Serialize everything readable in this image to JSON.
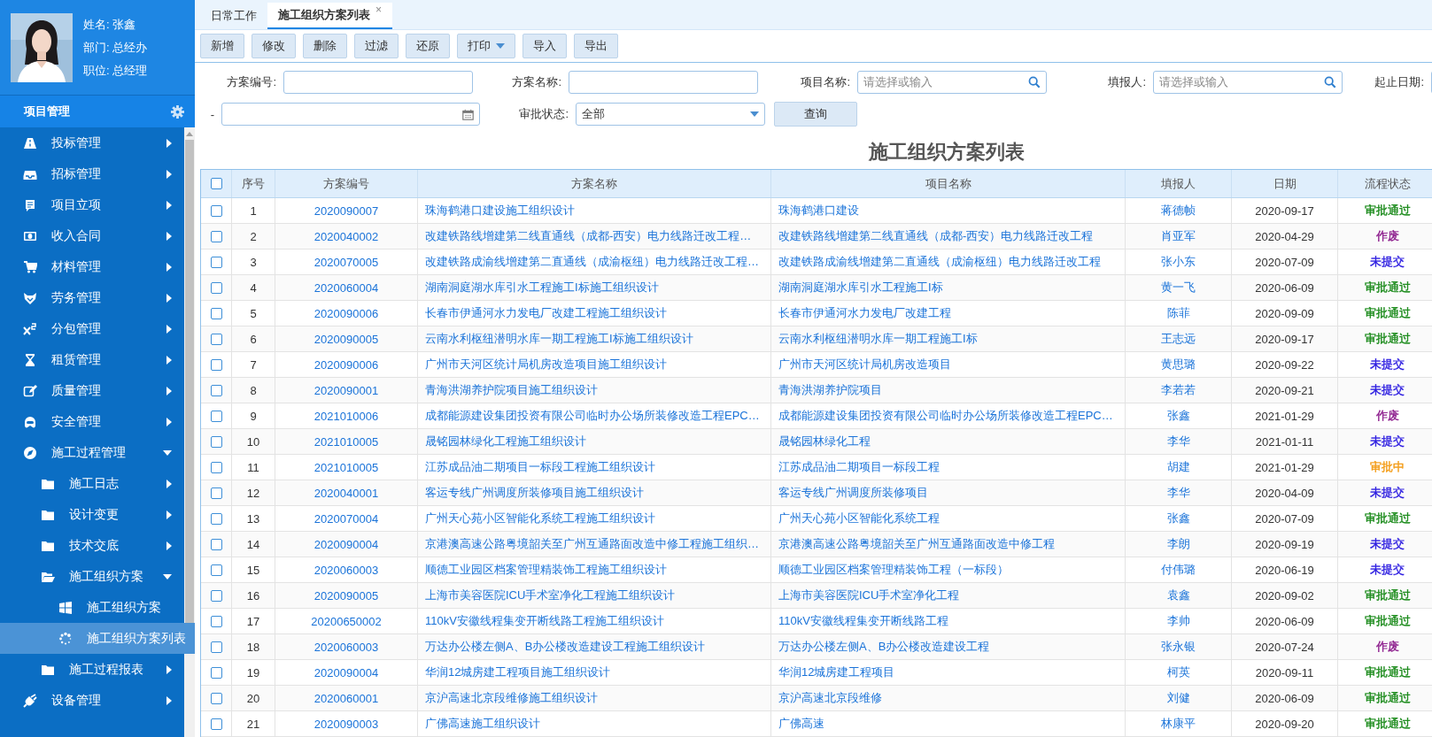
{
  "profile": {
    "lines": [
      "姓名: 张鑫",
      "部门: 总经办",
      "职位: 总经理"
    ]
  },
  "module": {
    "title": "项目管理"
  },
  "menu": [
    {
      "label": "投标管理",
      "expanded": false,
      "selected": false
    },
    {
      "label": "招标管理",
      "expanded": false,
      "selected": false
    },
    {
      "label": "项目立项",
      "expanded": false,
      "selected": false
    },
    {
      "label": "收入合同",
      "expanded": false,
      "selected": false
    },
    {
      "label": "材料管理",
      "expanded": false,
      "selected": false
    },
    {
      "label": "劳务管理",
      "expanded": false,
      "selected": false
    },
    {
      "label": "分包管理",
      "expanded": false,
      "selected": false
    },
    {
      "label": "租赁管理",
      "expanded": false,
      "selected": false
    },
    {
      "label": "质量管理",
      "expanded": false,
      "selected": false
    },
    {
      "label": "安全管理",
      "expanded": false,
      "selected": false
    },
    {
      "label": "施工过程管理",
      "expanded": true,
      "selected": false,
      "children": [
        {
          "label": "施工日志",
          "expanded": false,
          "selected": false
        },
        {
          "label": "设计变更",
          "expanded": false,
          "selected": false
        },
        {
          "label": "技术交底",
          "expanded": false,
          "selected": false
        },
        {
          "label": "施工组织方案",
          "expanded": true,
          "selected": false,
          "children": [
            {
              "label": "施工组织方案",
              "selected": false
            },
            {
              "label": "施工组织方案列表",
              "selected": true
            }
          ]
        },
        {
          "label": "施工过程报表",
          "expanded": false,
          "selected": false
        }
      ]
    },
    {
      "label": "设备管理",
      "expanded": false,
      "selected": false
    }
  ],
  "tabs": [
    {
      "label": "日常工作",
      "selected": false
    },
    {
      "label": "施工组织方案列表",
      "selected": true,
      "close": "×"
    }
  ],
  "toolbar": [
    {
      "label": "新增",
      "kind": "plain"
    },
    {
      "label": "修改",
      "kind": "plain"
    },
    {
      "label": "删除",
      "kind": "plain"
    },
    {
      "label": "过滤",
      "kind": "plain"
    },
    {
      "label": "还原",
      "kind": "plain"
    },
    {
      "label": "打印",
      "kind": "dropdown"
    },
    {
      "label": "导入",
      "kind": "plain"
    },
    {
      "label": "导出",
      "kind": "plain"
    }
  ],
  "filters": [
    {
      "label": "方案编号:",
      "kind": "text"
    },
    {
      "label": "方案名称:",
      "kind": "text"
    },
    {
      "label": "项目名称:",
      "kind": "search",
      "placeholder": "请选择或输入"
    },
    {
      "label": "填报人:",
      "kind": "search",
      "placeholder": "请选择或输入"
    },
    {
      "label": "起止日期:",
      "kind": "text"
    },
    {
      "label": "-",
      "kind": "date"
    },
    {
      "label": "审批状态:",
      "kind": "select",
      "value": "全部"
    }
  ],
  "query_button": "查询",
  "table": {
    "title": "施工组织方案列表",
    "header_checked": false,
    "columns": [
      "序号",
      "方案编号",
      "方案名称",
      "项目名称",
      "填报人",
      "日期",
      "流程状态"
    ],
    "rows": [
      {
        "checked": false,
        "no": "1",
        "code": "2020090007",
        "name": "珠海鹤港口建设施工组织设计",
        "project": "珠海鹤港口建设",
        "reporter": "蒋德帧",
        "date": "2020-09-17",
        "status": "审批通过",
        "color": "#1a8a1a"
      },
      {
        "checked": false,
        "no": "2",
        "code": "2020040002",
        "name": "改建铁路线增建第二线直通线（成都-西安）电力线路迁改工程…",
        "project": "改建铁路线增建第二线直通线（成都-西安）电力线路迁改工程",
        "reporter": "肖亚军",
        "date": "2020-04-29",
        "status": "作废",
        "color": "#8b1a8b"
      },
      {
        "checked": false,
        "no": "3",
        "code": "2020070005",
        "name": "改建铁路成渝线增建第二直通线（成渝枢纽）电力线路迁改工程…",
        "project": "改建铁路成渝线增建第二直通线（成渝枢纽）电力线路迁改工程",
        "reporter": "张小东",
        "date": "2020-07-09",
        "status": "未提交",
        "color": "#2a1ae0"
      },
      {
        "checked": false,
        "no": "4",
        "code": "2020060004",
        "name": "湖南洞庭湖水库引水工程施工I标施工组织设计",
        "project": "湖南洞庭湖水库引水工程施工I标",
        "reporter": "黄一飞",
        "date": "2020-06-09",
        "status": "审批通过",
        "color": "#1a8a1a"
      },
      {
        "checked": false,
        "no": "5",
        "code": "2020090006",
        "name": "长春市伊通河水力发电厂改建工程施工组织设计",
        "project": "长春市伊通河水力发电厂改建工程",
        "reporter": "陈菲",
        "date": "2020-09-09",
        "status": "审批通过",
        "color": "#1a8a1a"
      },
      {
        "checked": false,
        "no": "6",
        "code": "2020090005",
        "name": "云南水利枢纽潜明水库一期工程施工I标施工组织设计",
        "project": "云南水利枢纽潜明水库一期工程施工I标",
        "reporter": "王志远",
        "date": "2020-09-17",
        "status": "审批通过",
        "color": "#1a8a1a"
      },
      {
        "checked": false,
        "no": "7",
        "code": "2020090006",
        "name": "广州市天河区统计局机房改造项目施工组织设计",
        "project": "广州市天河区统计局机房改造项目",
        "reporter": "黄思璐",
        "date": "2020-09-22",
        "status": "未提交",
        "color": "#2a1ae0"
      },
      {
        "checked": false,
        "no": "8",
        "code": "2020090001",
        "name": "青海洪湖养护院项目施工组织设计",
        "project": "青海洪湖养护院项目",
        "reporter": "李若若",
        "date": "2020-09-21",
        "status": "未提交",
        "color": "#2a1ae0"
      },
      {
        "checked": false,
        "no": "9",
        "code": "2021010006",
        "name": "成都能源建设集团投资有限公司临时办公场所装修改造工程EPC…",
        "project": "成都能源建设集团投资有限公司临时办公场所装修改造工程EPC…",
        "reporter": "张鑫",
        "date": "2021-01-29",
        "status": "作废",
        "color": "#8b1a8b"
      },
      {
        "checked": false,
        "no": "10",
        "code": "2021010005",
        "name": "晟铭园林绿化工程施工组织设计",
        "project": "晟铭园林绿化工程",
        "reporter": "李华",
        "date": "2021-01-11",
        "status": "未提交",
        "color": "#2a1ae0"
      },
      {
        "checked": false,
        "no": "11",
        "code": "2021010005",
        "name": "江苏成品油二期项目一标段工程施工组织设计",
        "project": "江苏成品油二期项目一标段工程",
        "reporter": "胡建",
        "date": "2021-01-29",
        "status": "审批中",
        "color": "#f39a12"
      },
      {
        "checked": false,
        "no": "12",
        "code": "2020040001",
        "name": "客运专线广州调度所装修项目施工组织设计",
        "project": "客运专线广州调度所装修项目",
        "reporter": "李华",
        "date": "2020-04-09",
        "status": "未提交",
        "color": "#2a1ae0"
      },
      {
        "checked": false,
        "no": "13",
        "code": "2020070004",
        "name": "广州天心苑小区智能化系统工程施工组织设计",
        "project": "广州天心苑小区智能化系统工程",
        "reporter": "张鑫",
        "date": "2020-07-09",
        "status": "审批通过",
        "color": "#1a8a1a"
      },
      {
        "checked": false,
        "no": "14",
        "code": "2020090004",
        "name": "京港澳高速公路粤境韶关至广州互通路面改造中修工程施工组织…",
        "project": "京港澳高速公路粤境韶关至广州互通路面改造中修工程",
        "reporter": "李朗",
        "date": "2020-09-19",
        "status": "未提交",
        "color": "#2a1ae0"
      },
      {
        "checked": false,
        "no": "15",
        "code": "2020060003",
        "name": "顺德工业园区档案管理精装饰工程施工组织设计",
        "project": "顺德工业园区档案管理精装饰工程（一标段）",
        "reporter": "付伟璐",
        "date": "2020-06-19",
        "status": "未提交",
        "color": "#2a1ae0"
      },
      {
        "checked": false,
        "no": "16",
        "code": "2020090005",
        "name": "上海市美容医院ICU手术室净化工程施工组织设计",
        "project": "上海市美容医院ICU手术室净化工程",
        "reporter": "袁鑫",
        "date": "2020-09-02",
        "status": "审批通过",
        "color": "#1a8a1a"
      },
      {
        "checked": false,
        "no": "17",
        "code": "20200650002",
        "name": "110kV安徽线程集变开断线路工程施工组织设计",
        "project": "110kV安徽线程集变开断线路工程",
        "reporter": "李帅",
        "date": "2020-06-09",
        "status": "审批通过",
        "color": "#1a8a1a"
      },
      {
        "checked": false,
        "no": "18",
        "code": "2020060003",
        "name": "万达办公楼左侧A、B办公楼改造建设工程施工组织设计",
        "project": "万达办公楼左侧A、B办公楼改造建设工程",
        "reporter": "张永银",
        "date": "2020-07-24",
        "status": "作废",
        "color": "#8b1a8b"
      },
      {
        "checked": false,
        "no": "19",
        "code": "2020090004",
        "name": "华润12城房建工程项目施工组织设计",
        "project": "华润12城房建工程项目",
        "reporter": "柯英",
        "date": "2020-09-11",
        "status": "审批通过",
        "color": "#1a8a1a"
      },
      {
        "checked": false,
        "no": "20",
        "code": "2020060001",
        "name": "京沪高速北京段维修施工组织设计",
        "project": "京沪高速北京段维修",
        "reporter": "刘健",
        "date": "2020-06-09",
        "status": "审批通过",
        "color": "#1a8a1a"
      },
      {
        "checked": false,
        "no": "21",
        "code": "2020090003",
        "name": "广佛高速施工组织设计",
        "project": "广佛高速",
        "reporter": "林康平",
        "date": "2020-09-20",
        "status": "审批通过",
        "color": "#1a8a1a"
      }
    ]
  }
}
